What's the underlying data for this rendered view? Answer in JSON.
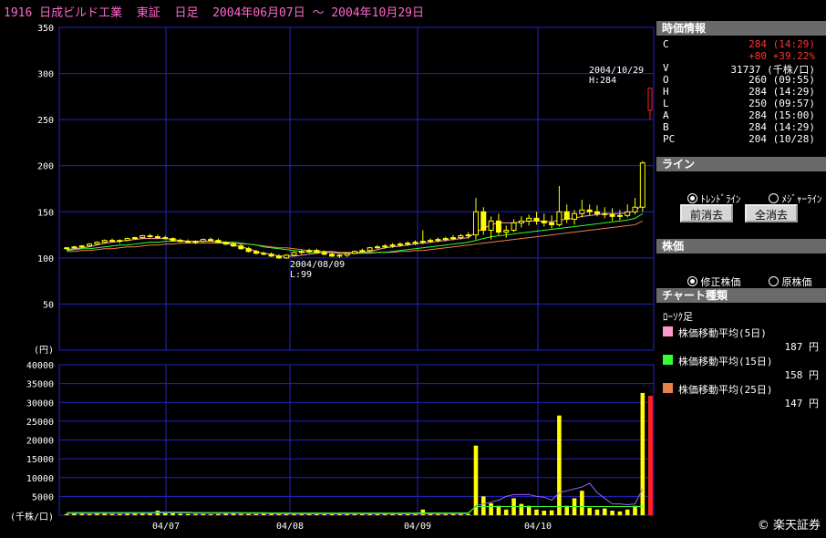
{
  "title": "1916 日成ビルド工業  東証  日足  2004年06月07日 ～ 2004年10月29日",
  "chart_data": [
    {
      "type": "candlestick",
      "name": "price",
      "ylim": [
        0,
        350
      ],
      "yticks": [
        50,
        100,
        150,
        200,
        250,
        300,
        350
      ],
      "ylabel": "(円)",
      "xticks": [
        "04/07",
        "04/08",
        "04/09",
        "04/10"
      ],
      "annotations": [
        {
          "date": "2004/08/09",
          "label": "2004/08/09\nL:99"
        },
        {
          "date": "2004/10/29",
          "label": "2004/10/29\nH:284"
        }
      ],
      "candles": [
        [
          110,
          112,
          109,
          111
        ],
        [
          111,
          113,
          110,
          112
        ],
        [
          112,
          114,
          111,
          113
        ],
        [
          113,
          116,
          112,
          115
        ],
        [
          115,
          118,
          114,
          117
        ],
        [
          117,
          120,
          116,
          119
        ],
        [
          119,
          121,
          117,
          118
        ],
        [
          118,
          120,
          116,
          119
        ],
        [
          119,
          122,
          118,
          121
        ],
        [
          121,
          123,
          120,
          122
        ],
        [
          122,
          125,
          121,
          124
        ],
        [
          124,
          126,
          122,
          123
        ],
        [
          123,
          125,
          121,
          122
        ],
        [
          122,
          124,
          120,
          121
        ],
        [
          121,
          122,
          118,
          119
        ],
        [
          119,
          121,
          117,
          118
        ],
        [
          118,
          120,
          116,
          117
        ],
        [
          117,
          119,
          115,
          118
        ],
        [
          118,
          121,
          117,
          120
        ],
        [
          120,
          122,
          118,
          119
        ],
        [
          119,
          121,
          116,
          117
        ],
        [
          117,
          118,
          114,
          115
        ],
        [
          115,
          117,
          112,
          113
        ],
        [
          113,
          115,
          109,
          110
        ],
        [
          110,
          112,
          106,
          107
        ],
        [
          107,
          109,
          104,
          105
        ],
        [
          105,
          107,
          103,
          104
        ],
        [
          104,
          106,
          101,
          102
        ],
        [
          102,
          104,
          99,
          100
        ],
        [
          100,
          104,
          99,
          103
        ],
        [
          103,
          107,
          102,
          106
        ],
        [
          106,
          109,
          104,
          107
        ],
        [
          107,
          110,
          105,
          108
        ],
        [
          108,
          110,
          105,
          106
        ],
        [
          106,
          108,
          103,
          104
        ],
        [
          104,
          106,
          101,
          102
        ],
        [
          102,
          104,
          100,
          103
        ],
        [
          103,
          106,
          101,
          105
        ],
        [
          105,
          108,
          104,
          107
        ],
        [
          107,
          110,
          106,
          108
        ],
        [
          108,
          112,
          107,
          111
        ],
        [
          111,
          114,
          110,
          112
        ],
        [
          112,
          115,
          110,
          113
        ],
        [
          113,
          116,
          111,
          114
        ],
        [
          114,
          117,
          112,
          115
        ],
        [
          115,
          118,
          113,
          116
        ],
        [
          116,
          119,
          114,
          117
        ],
        [
          117,
          130,
          115,
          118
        ],
        [
          118,
          121,
          116,
          119
        ],
        [
          119,
          122,
          117,
          120
        ],
        [
          120,
          123,
          118,
          121
        ],
        [
          121,
          125,
          119,
          122
        ],
        [
          122,
          126,
          120,
          124
        ],
        [
          124,
          128,
          121,
          125
        ],
        [
          125,
          165,
          120,
          150
        ],
        [
          150,
          155,
          125,
          130
        ],
        [
          130,
          145,
          120,
          140
        ],
        [
          140,
          148,
          125,
          128
        ],
        [
          128,
          135,
          122,
          130
        ],
        [
          130,
          142,
          128,
          138
        ],
        [
          138,
          145,
          133,
          140
        ],
        [
          140,
          147,
          135,
          143
        ],
        [
          143,
          150,
          136,
          140
        ],
        [
          140,
          148,
          134,
          138
        ],
        [
          138,
          146,
          132,
          136
        ],
        [
          136,
          178,
          134,
          150
        ],
        [
          150,
          158,
          138,
          142
        ],
        [
          142,
          152,
          136,
          148
        ],
        [
          148,
          163,
          144,
          152
        ],
        [
          152,
          158,
          146,
          150
        ],
        [
          150,
          157,
          145,
          148
        ],
        [
          148,
          155,
          143,
          147
        ],
        [
          147,
          154,
          140,
          145
        ],
        [
          145,
          152,
          141,
          146
        ],
        [
          146,
          158,
          144,
          150
        ],
        [
          150,
          165,
          147,
          155
        ],
        [
          155,
          205,
          150,
          203
        ]
      ],
      "ma5": [
        109,
        110,
        111,
        112,
        114,
        116,
        117,
        118,
        119,
        120,
        121,
        121,
        121,
        121,
        120,
        119,
        118,
        118,
        118,
        118,
        117,
        116,
        114,
        112,
        110,
        107,
        105,
        104,
        102,
        102,
        102,
        103,
        104,
        105,
        106,
        106,
        105,
        105,
        105,
        106,
        107,
        109,
        111,
        112,
        113,
        114,
        115,
        116,
        117,
        118,
        119,
        120,
        121,
        122,
        128,
        132,
        136,
        138,
        138,
        138,
        139,
        140,
        140,
        140,
        139,
        141,
        142,
        143,
        145,
        146,
        147,
        148,
        148,
        148,
        149,
        151,
        158
      ],
      "ma15": [
        108,
        109,
        110,
        110,
        111,
        112,
        113,
        114,
        114,
        115,
        116,
        117,
        117,
        118,
        118,
        118,
        118,
        118,
        118,
        118,
        118,
        117,
        117,
        116,
        115,
        114,
        112,
        111,
        110,
        109,
        108,
        107,
        106,
        106,
        106,
        106,
        105,
        105,
        105,
        105,
        105,
        106,
        106,
        107,
        108,
        109,
        110,
        111,
        112,
        113,
        114,
        115,
        116,
        117,
        119,
        121,
        123,
        124,
        125,
        126,
        127,
        128,
        129,
        130,
        131,
        132,
        133,
        134,
        135,
        136,
        137,
        138,
        139,
        140,
        141,
        143,
        148
      ],
      "ma25": [
        107,
        107,
        108,
        108,
        109,
        110,
        110,
        111,
        112,
        112,
        113,
        114,
        114,
        115,
        115,
        116,
        116,
        116,
        116,
        116,
        116,
        116,
        116,
        115,
        115,
        114,
        113,
        112,
        111,
        111,
        110,
        109,
        108,
        108,
        107,
        107,
        106,
        106,
        106,
        106,
        106,
        106,
        106,
        106,
        107,
        107,
        108,
        108,
        109,
        110,
        111,
        112,
        113,
        114,
        115,
        116,
        117,
        118,
        119,
        120,
        121,
        122,
        123,
        124,
        125,
        126,
        127,
        128,
        129,
        130,
        131,
        132,
        133,
        134,
        135,
        136,
        140
      ]
    },
    {
      "type": "bar",
      "name": "volume",
      "ylim": [
        0,
        40000
      ],
      "yticks": [
        5000,
        10000,
        15000,
        20000,
        25000,
        30000,
        35000,
        40000
      ],
      "ylabel": "(千株/口)",
      "values": [
        300,
        400,
        350,
        300,
        500,
        400,
        300,
        300,
        350,
        600,
        500,
        400,
        1200,
        800,
        500,
        400,
        350,
        300,
        300,
        250,
        300,
        400,
        500,
        300,
        300,
        300,
        400,
        350,
        300,
        300,
        250,
        250,
        250,
        250,
        300,
        250,
        250,
        250,
        300,
        250,
        300,
        250,
        250,
        300,
        350,
        250,
        300,
        1500,
        400,
        300,
        300,
        350,
        400,
        300,
        18500,
        5000,
        3200,
        2500,
        1500,
        4500,
        3000,
        2500,
        1500,
        1200,
        1300,
        26500,
        2500,
        4500,
        6500,
        2000,
        1500,
        1800,
        1200,
        1000,
        1500,
        2500,
        32500
      ],
      "volume_ma": [
        500,
        500,
        500,
        500,
        500,
        500,
        500,
        500,
        500,
        500,
        500,
        500,
        600,
        600,
        600,
        600,
        600,
        500,
        500,
        500,
        500,
        500,
        500,
        500,
        450,
        450,
        450,
        400,
        400,
        400,
        350,
        350,
        350,
        350,
        350,
        350,
        350,
        350,
        350,
        350,
        350,
        350,
        350,
        350,
        350,
        350,
        350,
        400,
        400,
        400,
        400,
        400,
        400,
        400,
        2500,
        3000,
        3500,
        4000,
        5000,
        5500,
        5500,
        5500,
        5000,
        4800,
        4000,
        6000,
        6500,
        7000,
        7500,
        8500,
        6000,
        4500,
        3000,
        3000,
        2800,
        3000,
        7000
      ]
    }
  ],
  "quote": {
    "header": "時価情報",
    "rows": [
      {
        "label": "C",
        "value": "284 (14:29)",
        "color": "#ff3333"
      },
      {
        "label": "",
        "value": "+80 +39.22%",
        "color": "#ff3333"
      },
      {
        "label": "V",
        "value": "31737 (千株/口)",
        "color": "#ffffff"
      },
      {
        "label": "O",
        "value": "260 (09:55)",
        "color": "#ffffff"
      },
      {
        "label": "H",
        "value": "284 (14:29)",
        "color": "#ffffff"
      },
      {
        "label": "L",
        "value": "250 (09:57)",
        "color": "#ffffff"
      },
      {
        "label": "A",
        "value": "284 (15:00)",
        "color": "#ffffff"
      },
      {
        "label": "B",
        "value": "284 (14:29)",
        "color": "#ffffff"
      },
      {
        "label": "PC",
        "value": "204 (10/28)",
        "color": "#ffffff"
      }
    ],
    "last_candle": [
      260,
      284,
      250,
      284
    ]
  },
  "line": {
    "header": "ライン",
    "trend_label": "ﾄﾚﾝﾄﾞﾗｲﾝ",
    "measure_label": "ﾒｼﾞｬｰﾗｲﾝ",
    "prev_clear": "前消去",
    "all_clear": "全消去"
  },
  "price": {
    "header": "株価",
    "adjusted": "修正株価",
    "original": "原株価"
  },
  "chart_type": {
    "header": "チャート種類",
    "candle_label": "ﾛｰｿｸ足",
    "legend": [
      {
        "label": "株価移動平均(5日)",
        "value": "187 円",
        "color": "#ff99cc"
      },
      {
        "label": "株価移動平均(15日)",
        "value": "158 円",
        "color": "#33ff33"
      },
      {
        "label": "株価移動平均(25日)",
        "value": "147 円",
        "color": "#e8824a"
      }
    ]
  },
  "copyright": "© 楽天証券"
}
